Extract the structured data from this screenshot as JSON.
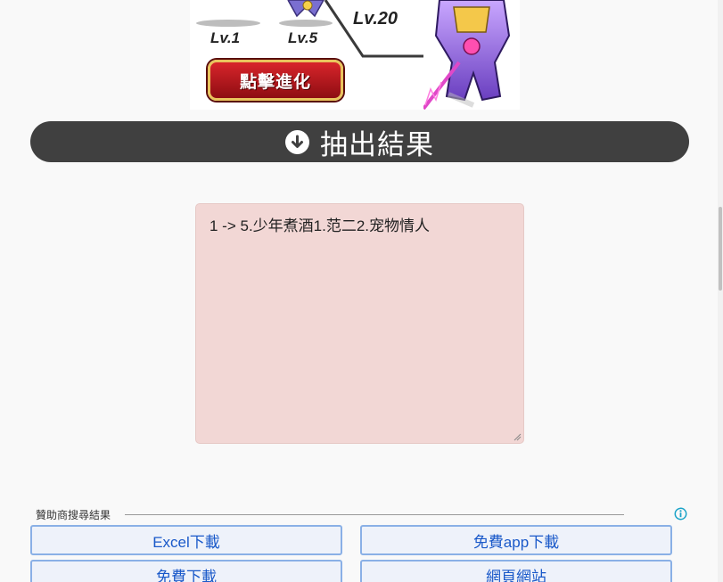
{
  "banner": {
    "levels": [
      "Lv.1",
      "Lv.5",
      "Lv.20"
    ],
    "cta_label": "點擊進化"
  },
  "result": {
    "icon": "arrow-down-circle-icon",
    "title": "抽出結果",
    "textarea_value": "1 -> 5.少年煮酒1.范二2.宠物情人"
  },
  "sponsored": {
    "label": "贊助商搜尋結果",
    "info_icon": "info-icon",
    "links": [
      "Excel下載",
      "免費app下載",
      "免費下載",
      "網頁網站"
    ]
  },
  "colors": {
    "bar_bg": "#404040",
    "textarea_bg": "#f2d7d5",
    "link_color": "#1a59c9",
    "button_border": "#8ab0e6"
  }
}
